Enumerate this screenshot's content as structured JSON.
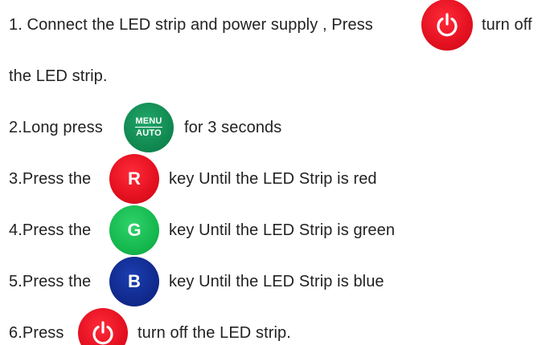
{
  "steps": [
    {
      "before": "1. Connect the LED strip and power supply , Press",
      "after": "turn off",
      "continuation": "the LED strip.",
      "button": {
        "icon": "power-icon",
        "color": "#e3101f"
      }
    },
    {
      "before": "2.Long press",
      "after": "for 3 seconds",
      "button": {
        "icon": "menu-auto-icon",
        "line1": "MENU",
        "line2": "AUTO",
        "color": "#118a52"
      }
    },
    {
      "before": "3.Press the",
      "after": "key Until the LED Strip is red",
      "button": {
        "icon": "r-key-icon",
        "letter": "R",
        "color": "#e3101f"
      }
    },
    {
      "before": "4.Press the",
      "after": "key Until the LED Strip is green",
      "button": {
        "icon": "g-key-icon",
        "letter": "G",
        "color": "#15b94e"
      }
    },
    {
      "before": "5.Press the",
      "after": "key Until the LED Strip is blue",
      "button": {
        "icon": "b-key-icon",
        "letter": "B",
        "color": "#112a8e"
      }
    },
    {
      "before": "6.Press",
      "after": "turn off the LED strip.",
      "button": {
        "icon": "power-icon",
        "color": "#e3101f"
      }
    }
  ]
}
